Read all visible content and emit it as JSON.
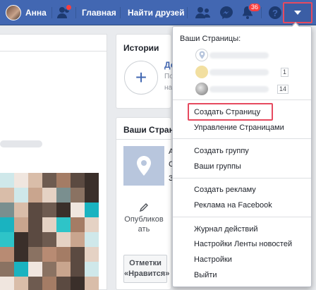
{
  "topbar": {
    "profile_name": "Анна",
    "home_label": "Главная",
    "find_friends_label": "Найти друзей",
    "notifications_count": "36",
    "colors": {
      "bar": "#4267b2",
      "highlight": "#e64a5f"
    }
  },
  "stories": {
    "title": "Истории",
    "add_symbol": "+",
    "frag_title": "До",
    "frag_line1": "По",
    "frag_line2": "на"
  },
  "your_pages_box": {
    "title": "Ваши Страни",
    "frag1": "А",
    "frag2": "С",
    "frag3": "З",
    "publish_label_1": "Опубликов",
    "publish_label_2": "ать",
    "likes_line1": "Отметки",
    "likes_line2": "«Нравится»"
  },
  "menu": {
    "pages_header": "Ваши Страницы:",
    "page_counts": [
      "",
      "1",
      "14"
    ],
    "create_page": "Создать Страницу",
    "manage_pages": "Управление Страницами",
    "create_group": "Создать группу",
    "your_groups": "Ваши группы",
    "create_ad": "Создать рекламу",
    "fb_ads": "Реклама на Facebook",
    "activity_log": "Журнал действий",
    "news_feed_prefs": "Настройки Ленты новостей",
    "settings": "Настройки",
    "logout": "Выйти"
  },
  "icons": [
    "avatar",
    "friend-requests-icon",
    "friends-icon",
    "messenger-icon",
    "bell-icon",
    "help-icon",
    "caret-down-icon",
    "plus-icon",
    "map-pin-icon",
    "pencil-icon"
  ]
}
